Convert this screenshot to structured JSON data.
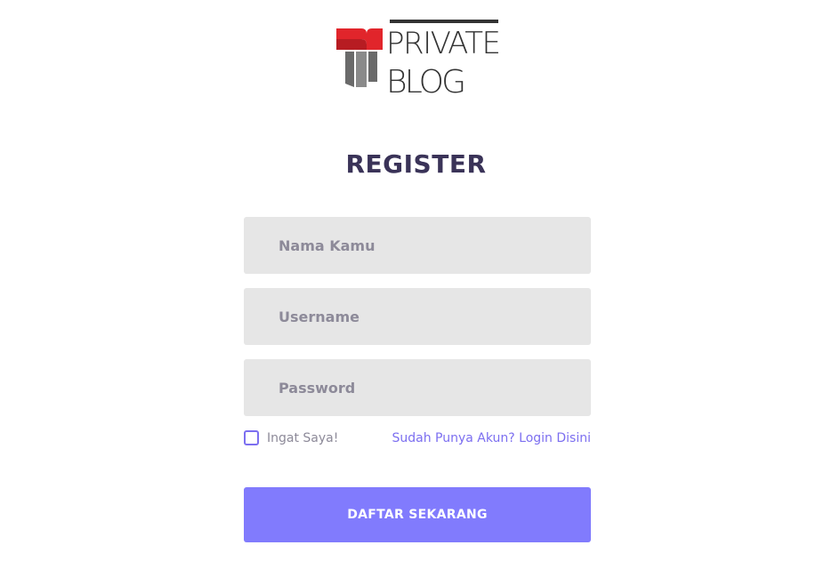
{
  "brand": {
    "logo_text_line1": "PRIVATE",
    "logo_text_line2": "BLOG",
    "logo_icon": "book-t-icon",
    "colors": {
      "icon_red": "#e1252b",
      "icon_gray": "#6a6a6a",
      "text_dark": "#333333"
    }
  },
  "form": {
    "title": "REGISTER",
    "fields": [
      {
        "name": "name",
        "placeholder": "Nama Kamu",
        "value": ""
      },
      {
        "name": "username",
        "placeholder": "Username",
        "value": ""
      },
      {
        "name": "password",
        "placeholder": "Password",
        "value": ""
      }
    ],
    "remember": {
      "label": "Ingat Saya!",
      "checked": false
    },
    "login_link": "Sudah Punya Akun? Login Disini",
    "submit_label": "DAFTAR SEKARANG"
  },
  "colors": {
    "title": "#3a3358",
    "input_bg": "#e6e6e6",
    "placeholder": "#8d8a99",
    "accent": "#7c6ff0",
    "button": "#817bfd"
  }
}
